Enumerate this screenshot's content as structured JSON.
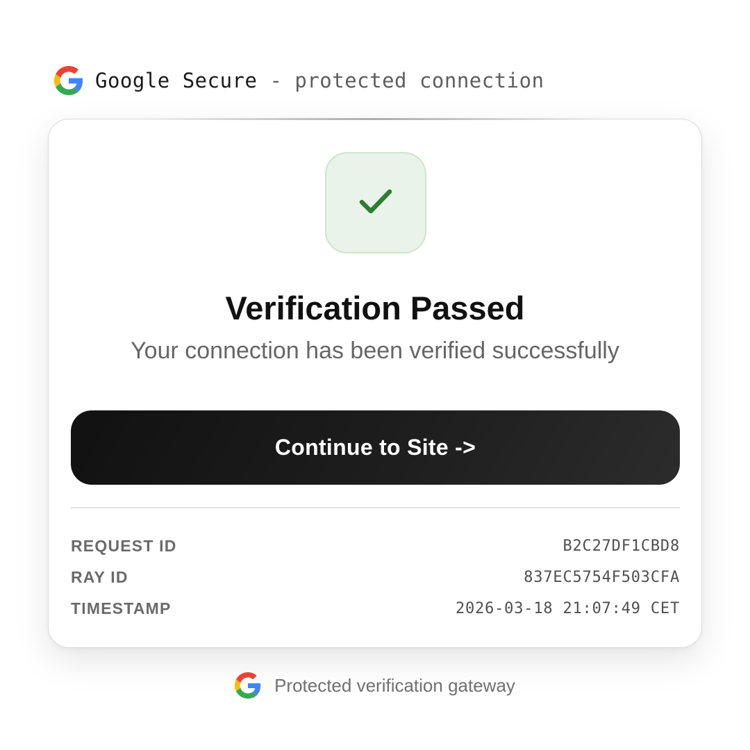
{
  "header": {
    "brand_name": "Google Secure",
    "tagline": " - protected connection",
    "logo_icon": "google-g-icon"
  },
  "card": {
    "status_icon": "checkmark-icon",
    "status_color": "#2e7d32",
    "status_tile_color": "#eaf3e9",
    "title": "Verification Passed",
    "subtitle": "Your connection has been verified successfully",
    "continue_label": "Continue to Site ->",
    "details": [
      {
        "label": "REQUEST ID",
        "value": "B2C27DF1CBD8"
      },
      {
        "label": "RAY ID",
        "value": "837EC5754F503CFA"
      },
      {
        "label": "TIMESTAMP",
        "value": "2026-03-18 21:07:49 CET"
      }
    ]
  },
  "footer": {
    "text": "Protected verification gateway",
    "logo_icon": "google-g-icon"
  },
  "colors": {
    "button_bg": "#111111",
    "google_blue": "#4285F4",
    "google_red": "#EA4335",
    "google_yellow": "#FBBC05",
    "google_green": "#34A853"
  }
}
